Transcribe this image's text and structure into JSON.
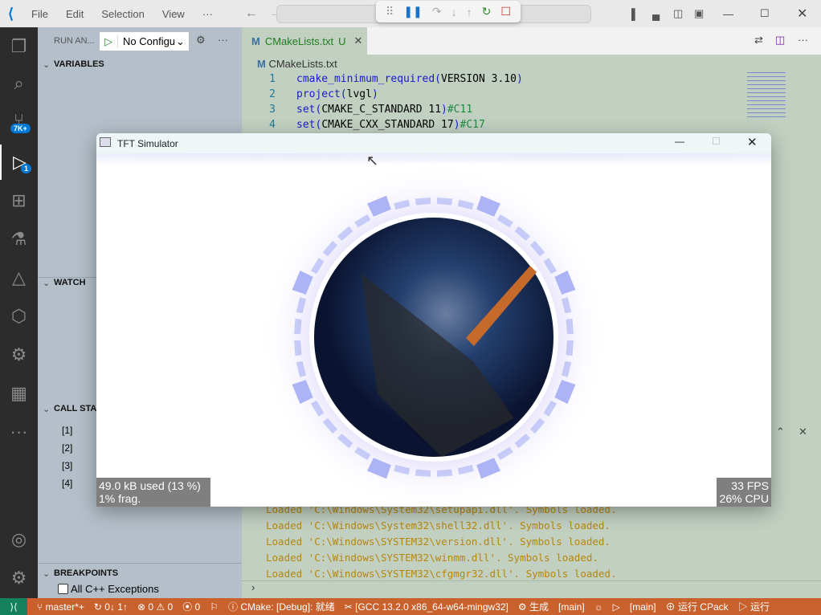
{
  "menu": [
    "File",
    "Edit",
    "Selection",
    "View",
    "···"
  ],
  "debug_toolbar": {
    "icons": [
      "drag-handle",
      "pause",
      "step-over",
      "step-into",
      "step-out",
      "restart",
      "stop"
    ]
  },
  "activity": {
    "scm_badge": "7K+",
    "debug_badge": "1"
  },
  "sidebar": {
    "run_label": "RUN AN...",
    "config": "No Configu",
    "variables": "VARIABLES",
    "watch": "WATCH",
    "call_stack": "CALL STACK",
    "frames": [
      "[1]",
      "[2]",
      "[3]",
      "[4]"
    ],
    "breakpoints": "BREAKPOINTS",
    "bp_item": "All C++ Exceptions"
  },
  "editor": {
    "tab": "CMakeLists.txt",
    "tab_status": "U",
    "breadcrumb": "CMakeLists.txt",
    "lines": [
      {
        "n": "1",
        "kw": "cmake_minimum_required(",
        "rest": "VERSION 3.10",
        "end": ")",
        "cm": ""
      },
      {
        "n": "2",
        "kw": "project(",
        "rest": "lvgl",
        "end": ")",
        "cm": ""
      },
      {
        "n": "3",
        "kw": "set(",
        "rest": "CMAKE_C_STANDARD 11",
        "end": ")",
        "cm": "#C11"
      },
      {
        "n": "4",
        "kw": "set(",
        "rest": "CMAKE_CXX_STANDARD 17",
        "end": ")",
        "cm": "#C17"
      }
    ]
  },
  "output": [
    "Loaded 'C:\\Windows\\System32\\setupapi.dll'. Symbols loaded.",
    "Loaded 'C:\\Windows\\System32\\shell32.dll'. Symbols loaded.",
    "Loaded 'C:\\Windows\\SYSTEM32\\version.dll'. Symbols loaded.",
    "Loaded 'C:\\Windows\\SYSTEM32\\winmm.dll'. Symbols loaded.",
    "Loaded 'C:\\Windows\\SYSTEM32\\cfgmgr32.dll'. Symbols loaded."
  ],
  "tft": {
    "title": "TFT Simulator",
    "mem_line1": "49.0 kB used (13 %)",
    "mem_line2": "1% frag.",
    "fps": "33 FPS",
    "cpu": "26% CPU",
    "ring_color": "#a9b0f5"
  },
  "status": {
    "branch": "master*+",
    "sync": "0↓ 1↑",
    "errors": "0",
    "warnings": "0",
    "ports": "0",
    "cmake": "CMake: [Debug]: 就绪",
    "kit": "[GCC 13.2.0 x86_64-w64-mingw32]",
    "build": "生成",
    "target1": "[main]",
    "target2": "[main]",
    "cpack": "运行 CPack",
    "run": "运行"
  },
  "colors": {
    "status_bar": "#c9612d",
    "remote": "#16825d",
    "activity": "#2c2c2c"
  }
}
